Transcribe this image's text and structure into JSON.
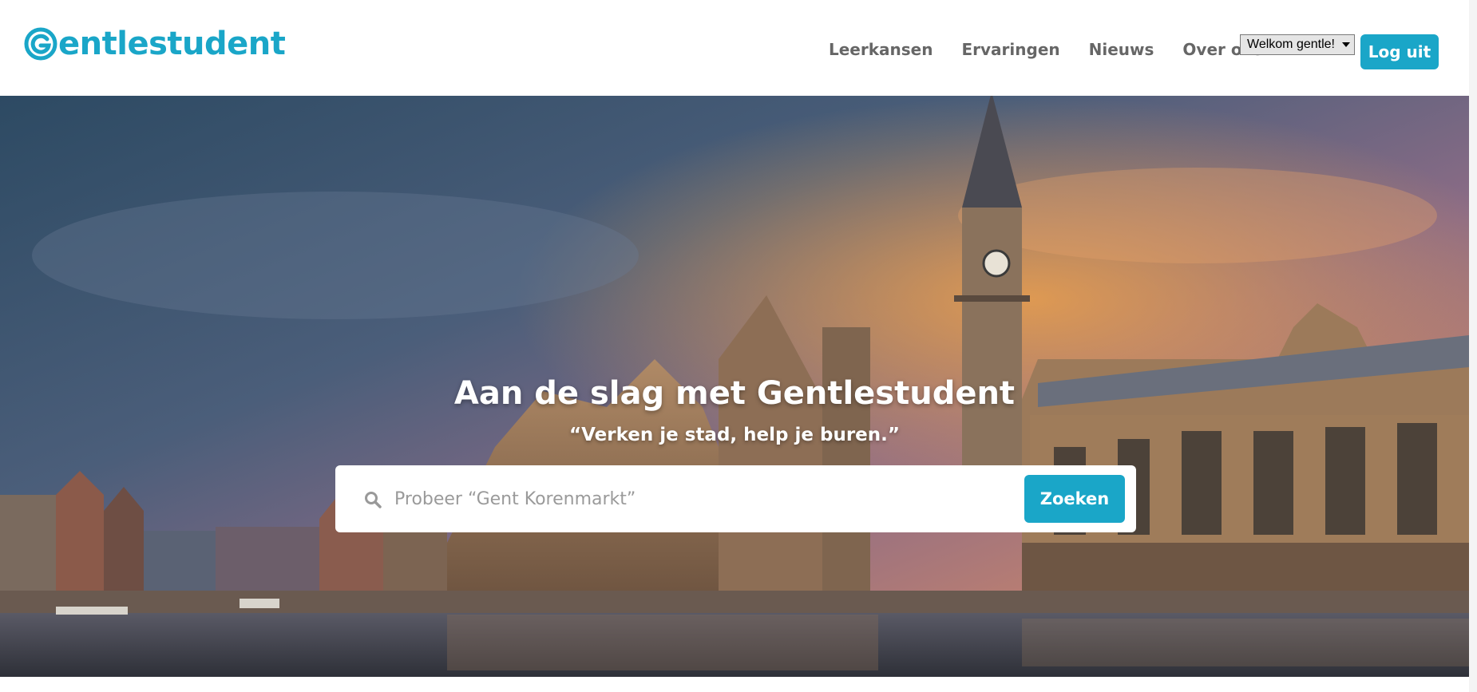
{
  "brand": {
    "name_rest": "entlestudent",
    "color": "#1aa6c8",
    "icon": "g-logo-icon"
  },
  "nav": {
    "items": [
      {
        "label": "Leerkansen"
      },
      {
        "label": "Ervaringen"
      },
      {
        "label": "Nieuws"
      },
      {
        "label": "Over ons"
      }
    ]
  },
  "user_menu": {
    "selected": "Welkom gentle!"
  },
  "logout": {
    "label": "Log uit"
  },
  "hero": {
    "title": "Aan de slag met Gentlestudent",
    "subtitle": "“Verken je stad, help je buren.”",
    "background": "Gent canal cityscape at sunset"
  },
  "search": {
    "placeholder": "Probeer “Gent Korenmarkt”",
    "value": "",
    "button_label": "Zoeken",
    "icon": "search-icon"
  },
  "colors": {
    "accent": "#1aa6c8",
    "nav_text": "#666666"
  }
}
